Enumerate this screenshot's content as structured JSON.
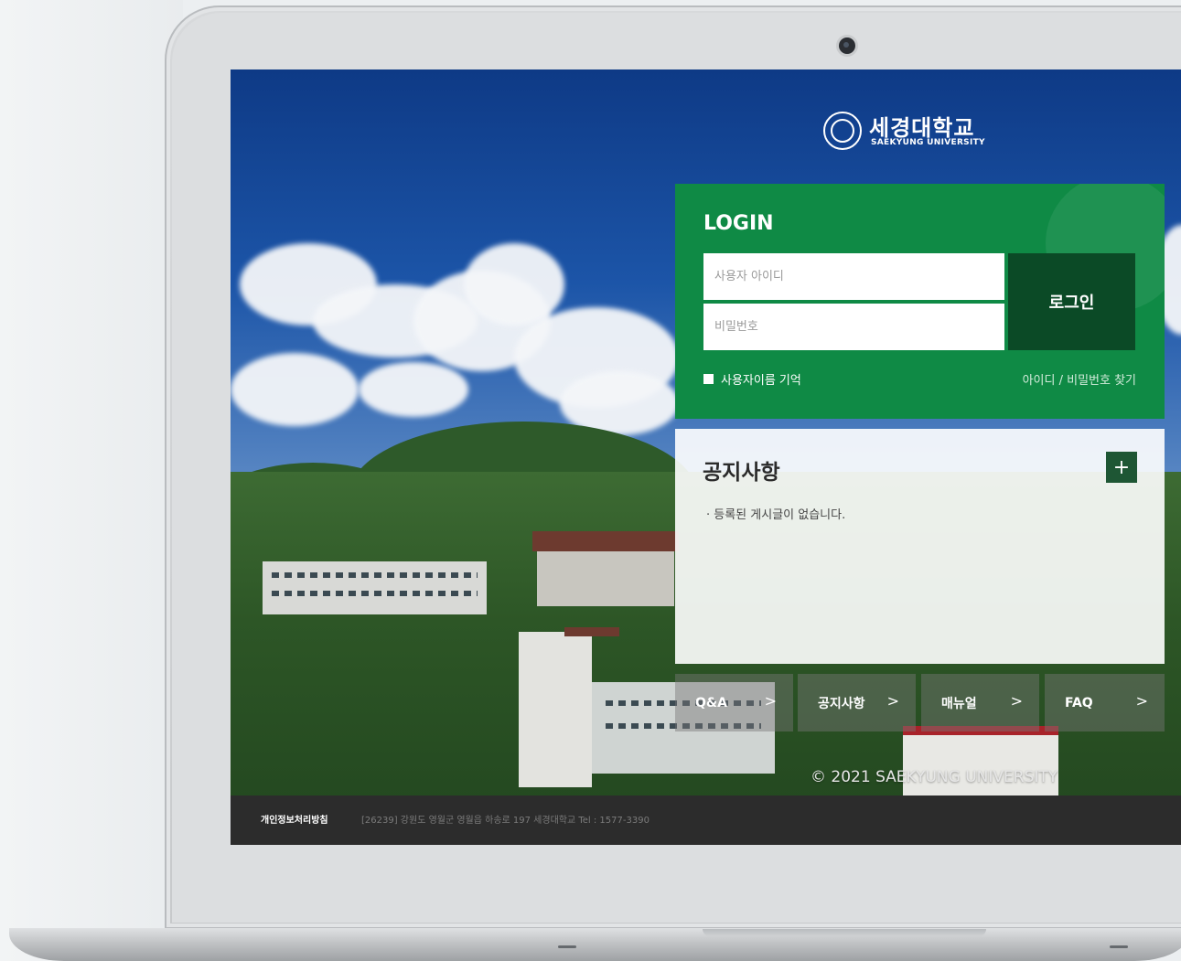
{
  "logo": {
    "name_ko": "세경대학교",
    "name_en": "SAEKYUNG UNIVERSITY"
  },
  "login": {
    "title": "LOGIN",
    "id_placeholder": "사용자 아이디",
    "pw_placeholder": "비밀번호",
    "button_label": "로그인",
    "remember_label": "사용자이름 기억",
    "find_link": "아이디 / 비밀번호 찾기"
  },
  "notice": {
    "title": "공지사항",
    "more_icon": "plus-icon",
    "empty_message": "· 등록된 게시글이 없습니다."
  },
  "quick_links": [
    {
      "label": "Q&A"
    },
    {
      "label": "공지사항"
    },
    {
      "label": "매뉴얼"
    },
    {
      "label": "FAQ"
    }
  ],
  "copyright": "© 2021 SAEKYUNG UNIVERSITY",
  "footer": {
    "privacy": "개인정보처리방침",
    "address": "[26239] 강원도 영월군 영월읍 하송로 197 세경대학교    Tel : 1577-3390"
  },
  "colors": {
    "login_green": "#0f8a45",
    "login_button": "#0b4a26",
    "notice_more": "#1e5634",
    "footer_bg": "#2c2c2c"
  }
}
